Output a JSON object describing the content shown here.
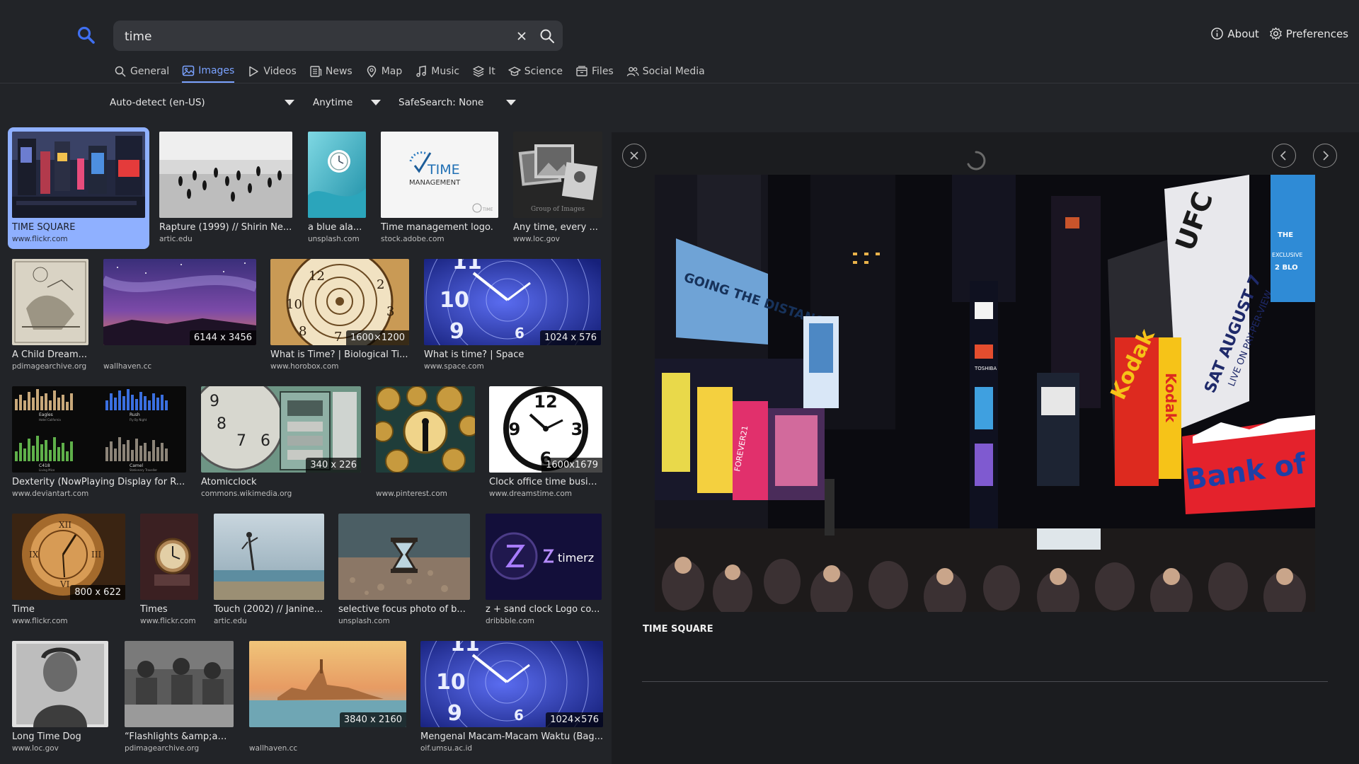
{
  "search": {
    "query": "time"
  },
  "top_links": {
    "about": "About",
    "preferences": "Preferences"
  },
  "categories": [
    "General",
    "Images",
    "Videos",
    "News",
    "Map",
    "Music",
    "It",
    "Science",
    "Files",
    "Social Media"
  ],
  "active_category": "Images",
  "filters": {
    "language": "Auto-detect (en-US)",
    "time": "Anytime",
    "safesearch": "SafeSearch: None"
  },
  "results": [
    {
      "title": "TIME SQUARE",
      "url": "www.flickr.com",
      "res": ""
    },
    {
      "title": "Rapture (1999) // Shirin Ne...",
      "url": "artic.edu",
      "res": ""
    },
    {
      "title": "a blue ala...",
      "url": "unsplash.com",
      "res": ""
    },
    {
      "title": "Time management logo.",
      "url": "stock.adobe.com",
      "res": ""
    },
    {
      "title": "Any time, every ...",
      "url": "www.loc.gov",
      "res": ""
    },
    {
      "title": "A Child Dream...",
      "url": "pdimagearchive.org",
      "res": ""
    },
    {
      "title": "",
      "url": "wallhaven.cc",
      "res": "6144 x 3456"
    },
    {
      "title": "What is Time? | Biological Ti...",
      "url": "www.horobox.com",
      "res": "1600×1200"
    },
    {
      "title": "What is time? | Space",
      "url": "www.space.com",
      "res": "1024 x 576"
    },
    {
      "title": "Dexterity (NowPlaying Display for R...",
      "url": "www.deviantart.com",
      "res": ""
    },
    {
      "title": "Atomicclock",
      "url": "commons.wikimedia.org",
      "res": "340 x 226"
    },
    {
      "title": "",
      "url": "www.pinterest.com",
      "res": ""
    },
    {
      "title": "Clock office time busin...",
      "url": "www.dreamstime.com",
      "res": "1600x1679"
    },
    {
      "title": "Time",
      "url": "www.flickr.com",
      "res": "800 x 622"
    },
    {
      "title": "Times",
      "url": "www.flickr.com",
      "res": ""
    },
    {
      "title": "Touch (2002) // Janine...",
      "url": "artic.edu",
      "res": ""
    },
    {
      "title": "selective focus photo of b...",
      "url": "unsplash.com",
      "res": ""
    },
    {
      "title": "z + sand clock Logo co...",
      "url": "dribbble.com",
      "res": ""
    },
    {
      "title": "Long Time Dog",
      "url": "www.loc.gov",
      "res": ""
    },
    {
      "title": "“Flashlights &amp;amp; ch...",
      "url": "pdimagearchive.org",
      "res": ""
    },
    {
      "title": "",
      "url": "wallhaven.cc",
      "res": "3840 x 2160"
    },
    {
      "title": "Mengenal Macam-Macam Waktu (Bag...",
      "url": "oif.umsu.ac.id",
      "res": "1024×576"
    }
  ],
  "thumb_text": {
    "time_logo_word": "TIME",
    "time_logo_sub": "MANAGEMENT",
    "time_logo_small": "TIME",
    "group_caption": "Group of Images",
    "timerz": "timerz",
    "np1": "Eagles",
    "np1b": "Hotel California",
    "np2": "Rush",
    "np2b": "Fly By Night",
    "np3": "C418",
    "np3b": "Living Mice",
    "np4": "Camel",
    "np4b": "Stationary Traveller"
  },
  "detail": {
    "title": "TIME SQUARE",
    "signs": {
      "distance": "GOING THE DISTANCE",
      "ufc": "UFC",
      "sat": "SAT AUGUST 7",
      "ppv": "LIVE ON PAY-PER-VIEW",
      "kodak": "Kodak",
      "kodak2": "Kodak",
      "bank": "Bank of Ame",
      "toshiba": "TOSHIBA",
      "forever": "FOREVER21",
      "exclusive": "EXCLUSIVE",
      "blocks": "2 BLO",
      "the": "THE"
    }
  },
  "colors": {
    "accent": "#7aa2ff",
    "selected_bg": "#8fb0ff",
    "bg": "#222428",
    "panel": "#1b1c1f"
  }
}
